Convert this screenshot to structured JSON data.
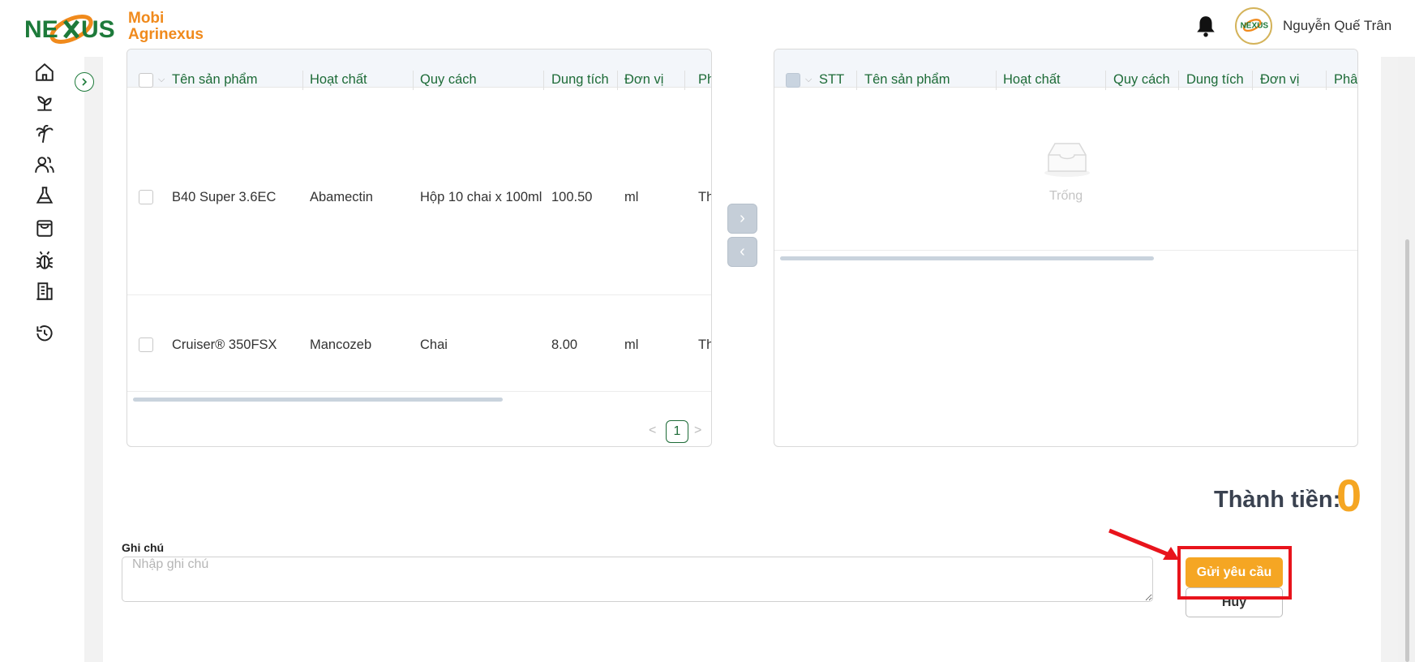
{
  "brand": {
    "line1": "Mobi",
    "line2": "Agrinexus"
  },
  "header": {
    "user_name": "Nguyễn Quế Trân"
  },
  "sidebar": {
    "icons": [
      "home-icon",
      "sprout-icon",
      "palm-tree-icon",
      "users-icon",
      "flask-icon",
      "shopping-bag-icon",
      "bug-icon",
      "building-icon",
      "history-icon"
    ]
  },
  "left_table": {
    "columns": [
      "Tên sản phẩm",
      "Hoạt chất",
      "Quy cách",
      "Dung tích",
      "Đơn vị",
      "Ph"
    ],
    "rows": [
      {
        "name": "B40 Super 3.6EC",
        "active": "Abamectin",
        "spec": "Hộp 10 chai x 100ml",
        "volume": "100.50",
        "unit": "ml",
        "extra": "Th"
      },
      {
        "name": "Cruiser® 350FSX",
        "active": "Mancozeb",
        "spec": "Chai",
        "volume": "8.00",
        "unit": "ml",
        "extra": "Th"
      }
    ],
    "pagination": {
      "current": "1"
    }
  },
  "right_table": {
    "columns": [
      "STT",
      "Tên sản phẩm",
      "Hoạt chất",
      "Quy cách",
      "Dung tích",
      "Đơn vị",
      "Phâ"
    ],
    "empty_text": "Trống"
  },
  "transfer": {
    "right": "›",
    "left": "‹"
  },
  "total": {
    "label": "Thành tiền:",
    "value": "0"
  },
  "note": {
    "label": "Ghi chú",
    "placeholder": "Nhập ghi chú"
  },
  "actions": {
    "send": "Gửi yêu cầu",
    "cancel": "Hủy"
  },
  "colors": {
    "primary": "#1d6b37",
    "accent": "#f5a623",
    "highlight": "#e8141c"
  }
}
